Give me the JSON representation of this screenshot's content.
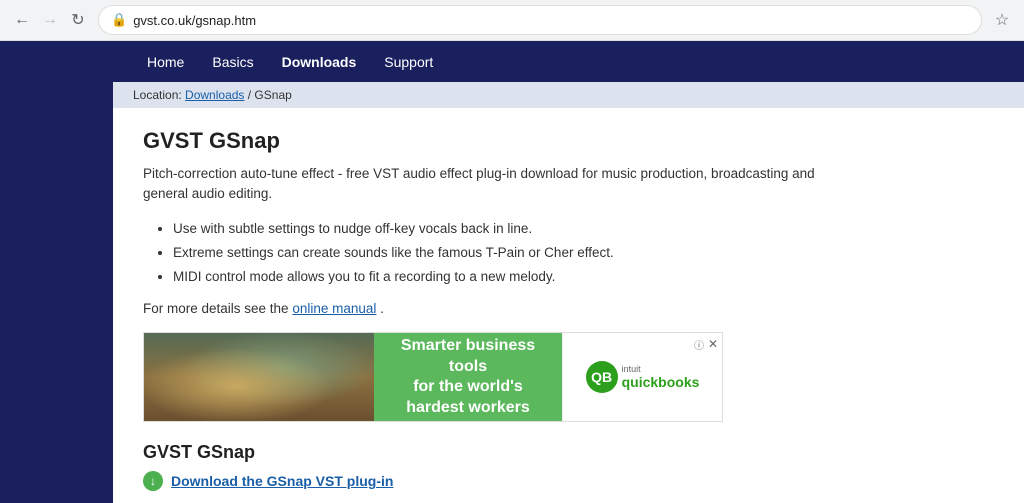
{
  "browser": {
    "url": "gvst.co.uk/gsnap.htm",
    "back_disabled": false,
    "forward_disabled": true
  },
  "nav": {
    "items": [
      {
        "label": "Home",
        "active": false
      },
      {
        "label": "Basics",
        "active": false
      },
      {
        "label": "Downloads",
        "active": true
      },
      {
        "label": "Support",
        "active": false
      }
    ]
  },
  "breadcrumb": {
    "prefix": "Location:",
    "link_text": "Downloads",
    "separator": "/ GSnap"
  },
  "content": {
    "title": "GVST GSnap",
    "description": "Pitch-correction auto-tune effect - free VST audio effect plug-in download for music production, broadcasting and general audio editing.",
    "features": [
      "Use with subtle settings to nudge off-key vocals back in line.",
      "Extreme settings can create sounds like the famous T-Pain or Cher effect.",
      "MIDI control mode allows you to fit a recording to a new melody."
    ],
    "manual_prefix": "For more details see the",
    "manual_link": "online manual",
    "manual_suffix": "."
  },
  "ad": {
    "green_text_line1": "Smarter business tools",
    "green_text_line2": "for the world's hardest workers",
    "intuit_label": "intuit",
    "brand": "quickbooks"
  },
  "download": {
    "title": "GVST GSnap",
    "link_text": "Download the GSnap VST plug-in",
    "icon": "↓"
  }
}
